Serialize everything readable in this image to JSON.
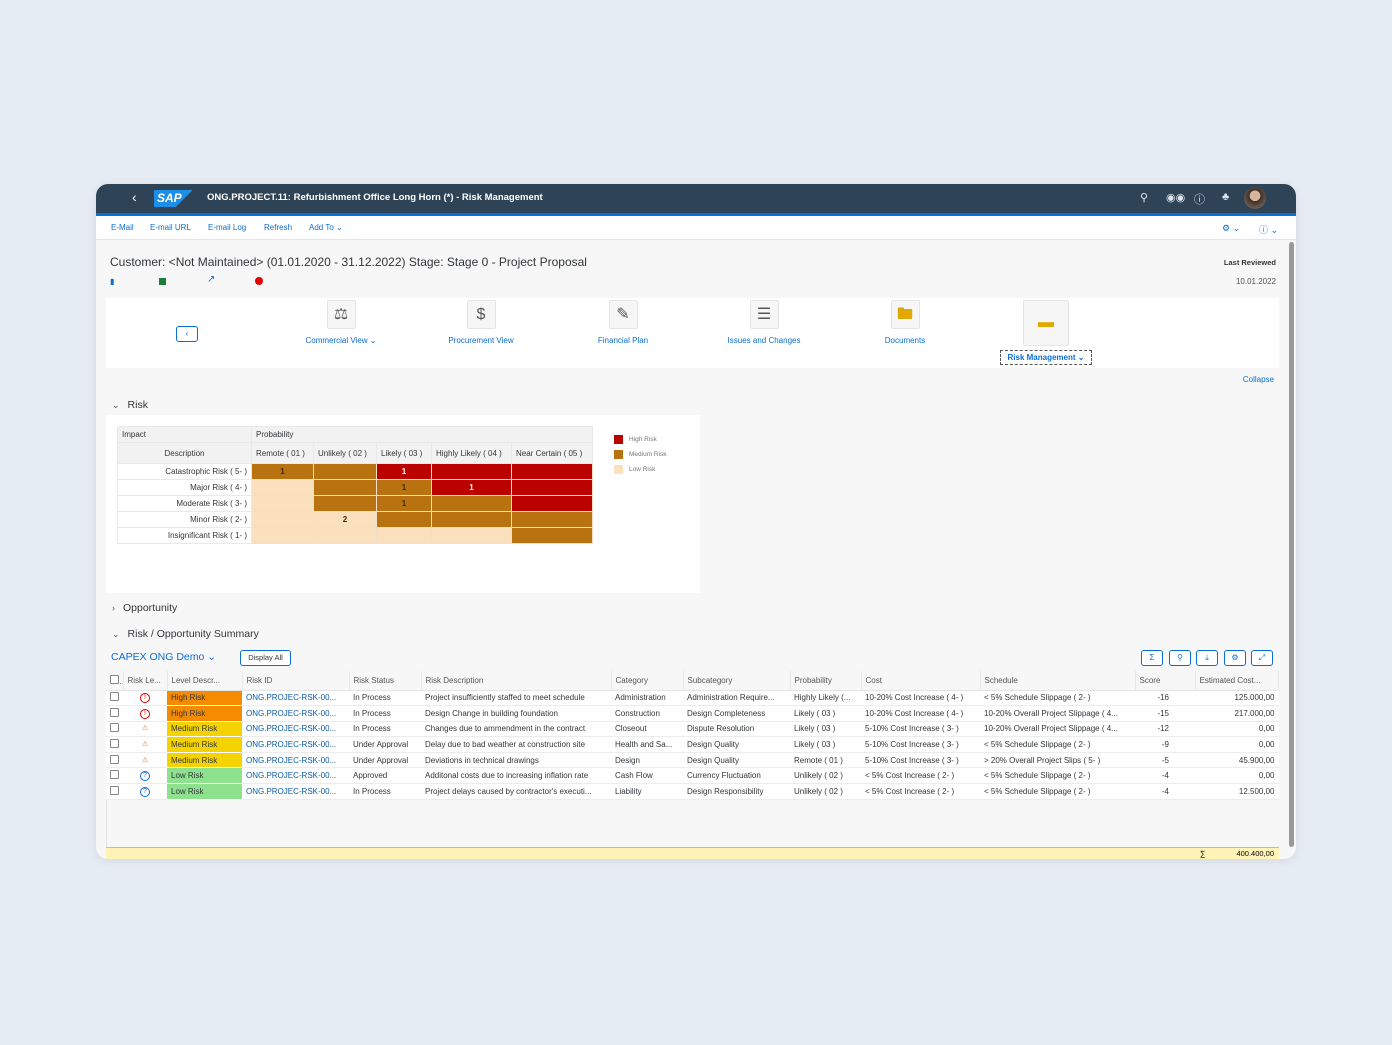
{
  "shell": {
    "title": "ONG.PROJECT.11: Refurbishment Office Long Horn (*) - Risk Management",
    "logo": "SAP"
  },
  "toolbar": {
    "items": [
      "E-Mail",
      "E-mail URL",
      "E-mail Log",
      "Refresh",
      "Add To"
    ]
  },
  "header": {
    "title": "Customer: <Not Maintained> (01.01.2020 - 31.12.2022) Stage: Stage 0 - Project Proposal",
    "last_reviewed_label": "Last Reviewed",
    "last_reviewed_date": "10.01.2022"
  },
  "nav": {
    "items": [
      {
        "label": "Commercial View",
        "dropdown": true
      },
      {
        "label": "Procurement View"
      },
      {
        "label": "Financial Plan"
      },
      {
        "label": "Issues and Changes"
      },
      {
        "label": "Documents"
      },
      {
        "label": "Risk Management",
        "dropdown": true,
        "selected": true
      }
    ],
    "collapse": "Collapse"
  },
  "sections": {
    "risk": "Risk",
    "opportunity": "Opportunity",
    "summary": "Risk / Opportunity Summary"
  },
  "matrix": {
    "impact_label": "Impact",
    "probability_label": "Probability",
    "description_label": "Description",
    "columns": [
      "Remote ( 01 )",
      "Unlikely ( 02 )",
      "Likely ( 03 )",
      "Highly Likely ( 04 )",
      "Near Certain ( 05 )"
    ],
    "rows": [
      {
        "label": "Catastrophic Risk ( 5- )",
        "levels": [
          "M",
          "M",
          "H",
          "H",
          "H"
        ],
        "counts": [
          "1",
          "",
          "1",
          "",
          ""
        ]
      },
      {
        "label": "Major Risk ( 4- )",
        "levels": [
          "L",
          "M",
          "M",
          "H",
          "H"
        ],
        "counts": [
          "",
          "",
          "1",
          "1",
          ""
        ]
      },
      {
        "label": "Moderate Risk ( 3- )",
        "levels": [
          "L",
          "M",
          "M",
          "M",
          "H"
        ],
        "counts": [
          "",
          "",
          "1",
          "",
          ""
        ]
      },
      {
        "label": "Minor Risk ( 2- )",
        "levels": [
          "L",
          "L",
          "M",
          "M",
          "M"
        ],
        "counts": [
          "",
          "2",
          "",
          "",
          ""
        ]
      },
      {
        "label": "Insignificant Risk ( 1- )",
        "levels": [
          "L",
          "L",
          "L",
          "L",
          "M"
        ],
        "counts": [
          "",
          "",
          "",
          "",
          ""
        ]
      }
    ],
    "legend": [
      {
        "label": "High Risk",
        "color": "#bb0000"
      },
      {
        "label": "Medium Risk",
        "color": "#b8720f"
      },
      {
        "label": "Low Risk",
        "color": "#fae0bd"
      }
    ]
  },
  "summary_table": {
    "variant": "CAPEX ONG Demo",
    "display_all": "Display All",
    "columns": [
      "Risk Le...",
      "Level Descr...",
      "Risk ID",
      "Risk Status",
      "Risk Description",
      "Category",
      "Subcategory",
      "Probability",
      "Cost",
      "Schedule",
      "Score",
      "Estimated Cost..."
    ],
    "rows": [
      {
        "icon": "error",
        "level": "High Risk",
        "id": "ONG.PROJEC-RSK-00...",
        "status": "In Process",
        "desc": "Project insufficiently staffed to meet schedule",
        "cat": "Administration",
        "sub": "Administration Require...",
        "prob": "Highly Likely (...",
        "cost": "10-20% Cost Increase ( 4- )",
        "sched": "< 5% Schedule Slippage ( 2- )",
        "score": "-16",
        "est": "125.000,00"
      },
      {
        "icon": "error",
        "level": "High Risk",
        "id": "ONG.PROJEC-RSK-00...",
        "status": "In Process",
        "desc": "Design Change in building foundation",
        "cat": "Construction",
        "sub": "Design Completeness",
        "prob": "Likely ( 03 )",
        "cost": "10-20% Cost Increase ( 4- )",
        "sched": "10-20% Overall Project Slippage ( 4...",
        "score": "-15",
        "est": "217.000,00"
      },
      {
        "icon": "warning",
        "level": "Medium Risk",
        "id": "ONG.PROJEC-RSK-00...",
        "status": "In Process",
        "desc": "Changes due to ammendment in the contract",
        "cat": "Closeout",
        "sub": "Dispute Resolution",
        "prob": "Likely ( 03 )",
        "cost": "5-10% Cost Increase ( 3- )",
        "sched": "10-20% Overall Project Slippage ( 4...",
        "score": "-12",
        "est": "0,00"
      },
      {
        "icon": "warning",
        "level": "Medium Risk",
        "id": "ONG.PROJEC-RSK-00...",
        "status": "Under Approval",
        "desc": "Delay due to bad weather at construction site",
        "cat": "Health and Sa...",
        "sub": "Design Quality",
        "prob": "Likely ( 03 )",
        "cost": "5-10% Cost Increase ( 3- )",
        "sched": "< 5% Schedule Slippage ( 2- )",
        "score": "-9",
        "est": "0,00"
      },
      {
        "icon": "warning",
        "level": "Medium Risk",
        "id": "ONG.PROJEC-RSK-00...",
        "status": "Under Approval",
        "desc": "Deviations in technical drawings",
        "cat": "Design",
        "sub": "Design Quality",
        "prob": "Remote ( 01 )",
        "cost": "5-10% Cost Increase ( 3- )",
        "sched": "> 20% Overall Project Slips ( 5- )",
        "score": "-5",
        "est": "45.900,00"
      },
      {
        "icon": "question",
        "level": "Low Risk",
        "id": "ONG.PROJEC-RSK-00...",
        "status": "Approved",
        "desc": "Additonal costs due to increasing inflation rate",
        "cat": "Cash Flow",
        "sub": "Currency Fluctuation",
        "prob": "Unlikely ( 02 )",
        "cost": "< 5% Cost Increase ( 2- )",
        "sched": "< 5% Schedule Slippage ( 2- )",
        "score": "-4",
        "est": "0,00"
      },
      {
        "icon": "question",
        "level": "Low Risk",
        "id": "ONG.PROJEC-RSK-00...",
        "status": "In Process",
        "desc": "Project delays caused by contractor's executi...",
        "cat": "Liability",
        "sub": "Design Responsibility",
        "prob": "Unlikely ( 02 )",
        "cost": "< 5% Cost Increase ( 2- )",
        "sched": "< 5% Schedule Slippage ( 2- )",
        "score": "-4",
        "est": "12.500,00"
      }
    ],
    "total_symbol": "∑",
    "total": "400.400,00",
    "level_colors": {
      "High Risk": "#f58b00",
      "Medium Risk": "#f5d300",
      "Low Risk": "#8ee28e"
    }
  }
}
